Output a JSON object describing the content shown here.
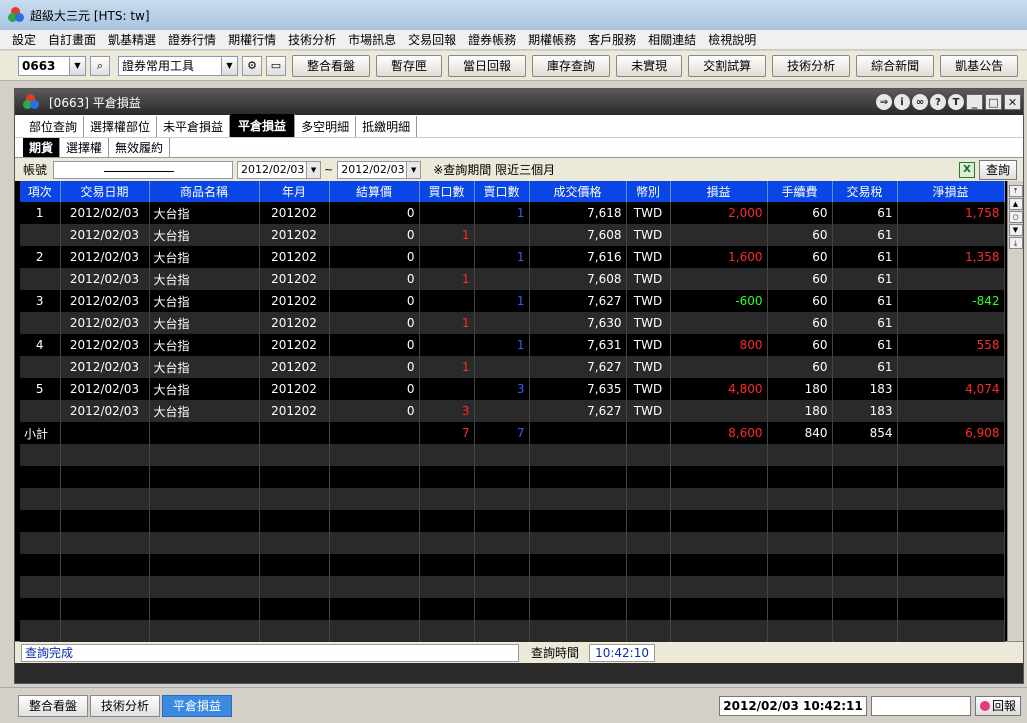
{
  "app": {
    "title": "超級大三元  [HTS: tw]"
  },
  "menu": [
    "設定",
    "自訂畫面",
    "凱基精選",
    "證券行情",
    "期權行情",
    "技術分析",
    "市場訊息",
    "交易回報",
    "證券帳務",
    "期權帳務",
    "客戶服務",
    "相關連結",
    "檢視說明"
  ],
  "toolbar": {
    "code": "0663",
    "tool_select": "證券常用工具",
    "buttons": [
      "整合看盤",
      "暫存匣",
      "當日回報",
      "庫存查詢",
      "未實現",
      "交割試算",
      "技術分析",
      "綜合新聞",
      "凱基公告"
    ]
  },
  "window": {
    "title": "[0663] 平倉損益",
    "tabs": [
      "部位查詢",
      "選擇權部位",
      "未平倉損益",
      "平倉損益",
      "多空明細",
      "抵繳明細"
    ],
    "active_tab": 3,
    "subtabs": [
      "期貨",
      "選擇權",
      "無效履約"
    ],
    "active_subtab": 0
  },
  "query": {
    "account_label": "帳號",
    "date_from": "2012/02/03",
    "date_sep": "~",
    "date_to": "2012/02/03",
    "note": "※查詢期間 限近三個月",
    "excel": "X",
    "query_btn": "查詢"
  },
  "table": {
    "headers": [
      "項次",
      "交易日期",
      "商品名稱",
      "年月",
      "結算價",
      "買口數",
      "賣口數",
      "成交價格",
      "幣別",
      "損益",
      "手續費",
      "交易稅",
      "淨損益"
    ],
    "rows": [
      [
        "1",
        "2012/02/03",
        "大台指",
        "201202",
        "0",
        "",
        "1",
        "7,618",
        "TWD",
        "2,000",
        "60",
        "61",
        "1,758"
      ],
      [
        "",
        "2012/02/03",
        "大台指",
        "201202",
        "0",
        "1",
        "",
        "7,608",
        "TWD",
        "",
        "60",
        "61",
        ""
      ],
      [
        "2",
        "2012/02/03",
        "大台指",
        "201202",
        "0",
        "",
        "1",
        "7,616",
        "TWD",
        "1,600",
        "60",
        "61",
        "1,358"
      ],
      [
        "",
        "2012/02/03",
        "大台指",
        "201202",
        "0",
        "1",
        "",
        "7,608",
        "TWD",
        "",
        "60",
        "61",
        ""
      ],
      [
        "3",
        "2012/02/03",
        "大台指",
        "201202",
        "0",
        "",
        "1",
        "7,627",
        "TWD",
        "-600",
        "60",
        "61",
        "-842"
      ],
      [
        "",
        "2012/02/03",
        "大台指",
        "201202",
        "0",
        "1",
        "",
        "7,630",
        "TWD",
        "",
        "60",
        "61",
        ""
      ],
      [
        "4",
        "2012/02/03",
        "大台指",
        "201202",
        "0",
        "",
        "1",
        "7,631",
        "TWD",
        "800",
        "60",
        "61",
        "558"
      ],
      [
        "",
        "2012/02/03",
        "大台指",
        "201202",
        "0",
        "1",
        "",
        "7,627",
        "TWD",
        "",
        "60",
        "61",
        ""
      ],
      [
        "5",
        "2012/02/03",
        "大台指",
        "201202",
        "0",
        "",
        "3",
        "7,635",
        "TWD",
        "4,800",
        "180",
        "183",
        "4,074"
      ],
      [
        "",
        "2012/02/03",
        "大台指",
        "201202",
        "0",
        "3",
        "",
        "7,627",
        "TWD",
        "",
        "180",
        "183",
        ""
      ],
      [
        "小計",
        "",
        "",
        "",
        "",
        "7",
        "7",
        "",
        "",
        "8,600",
        "840",
        "854",
        "6,908"
      ]
    ],
    "empty_rows": 9
  },
  "status": {
    "message": "查詢完成",
    "time_label": "查詢時間",
    "time": "10:42:10"
  },
  "bottom": {
    "tabs": [
      "整合看盤",
      "技術分析",
      "平倉損益"
    ],
    "active_tab": 2,
    "clock": "2012/02/03 10:42:11",
    "reply": "回報"
  }
}
